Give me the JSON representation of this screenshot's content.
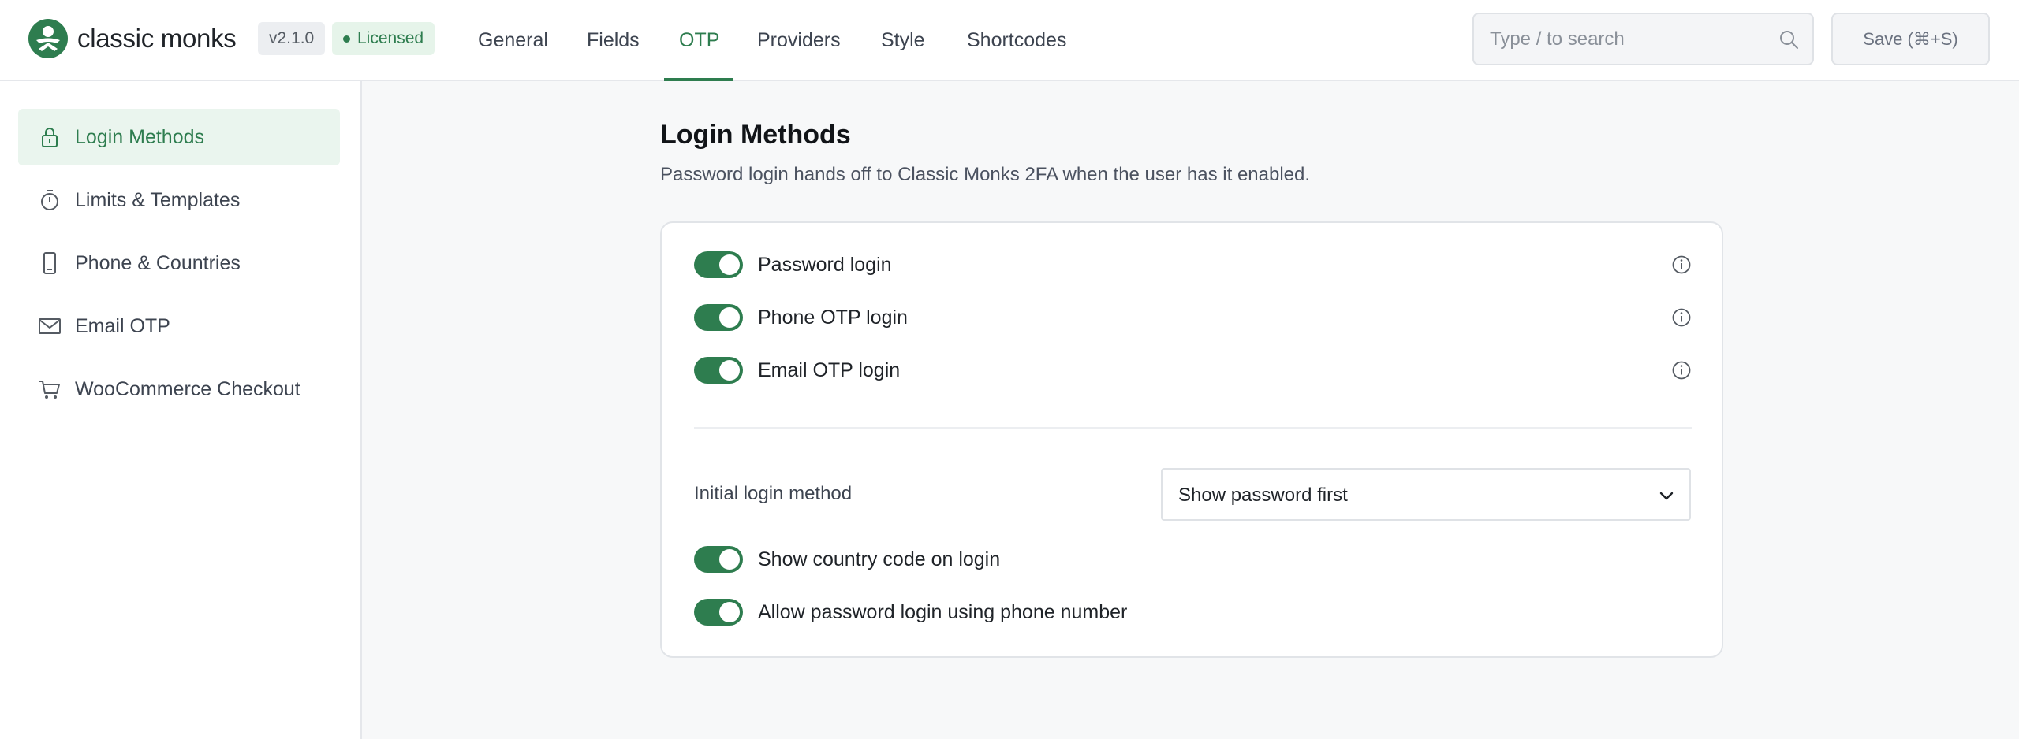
{
  "brand": {
    "name": "classic monks",
    "version": "v2.1.0",
    "license": "Licensed",
    "accent": "#2e7d4f"
  },
  "nav": {
    "tabs": [
      {
        "label": "General"
      },
      {
        "label": "Fields"
      },
      {
        "label": "OTP",
        "active": true
      },
      {
        "label": "Providers"
      },
      {
        "label": "Style"
      },
      {
        "label": "Shortcodes"
      }
    ]
  },
  "search": {
    "placeholder": "Type / to search",
    "value": ""
  },
  "toolbar": {
    "save_label": "Save (⌘+S)"
  },
  "sidebar": {
    "items": [
      {
        "label": "Login Methods",
        "icon": "lock-icon",
        "active": true
      },
      {
        "label": "Limits & Templates",
        "icon": "timer-icon"
      },
      {
        "label": "Phone & Countries",
        "icon": "phone-icon"
      },
      {
        "label": "Email OTP",
        "icon": "mail-icon"
      },
      {
        "label": "WooCommerce Checkout",
        "icon": "cart-icon"
      }
    ]
  },
  "main": {
    "title": "Login Methods",
    "subtitle": "Password login hands off to Classic Monks 2FA when the user has it enabled.",
    "toggles": [
      {
        "label": "Password login",
        "enabled": true
      },
      {
        "label": "Phone OTP login",
        "enabled": true
      },
      {
        "label": "Email OTP login",
        "enabled": true
      }
    ],
    "initial_method": {
      "label": "Initial login method",
      "value": "Show password first"
    },
    "extra_toggles": [
      {
        "label": "Show country code on login",
        "enabled": true
      },
      {
        "label": "Allow password login using phone number",
        "enabled": true
      }
    ]
  }
}
